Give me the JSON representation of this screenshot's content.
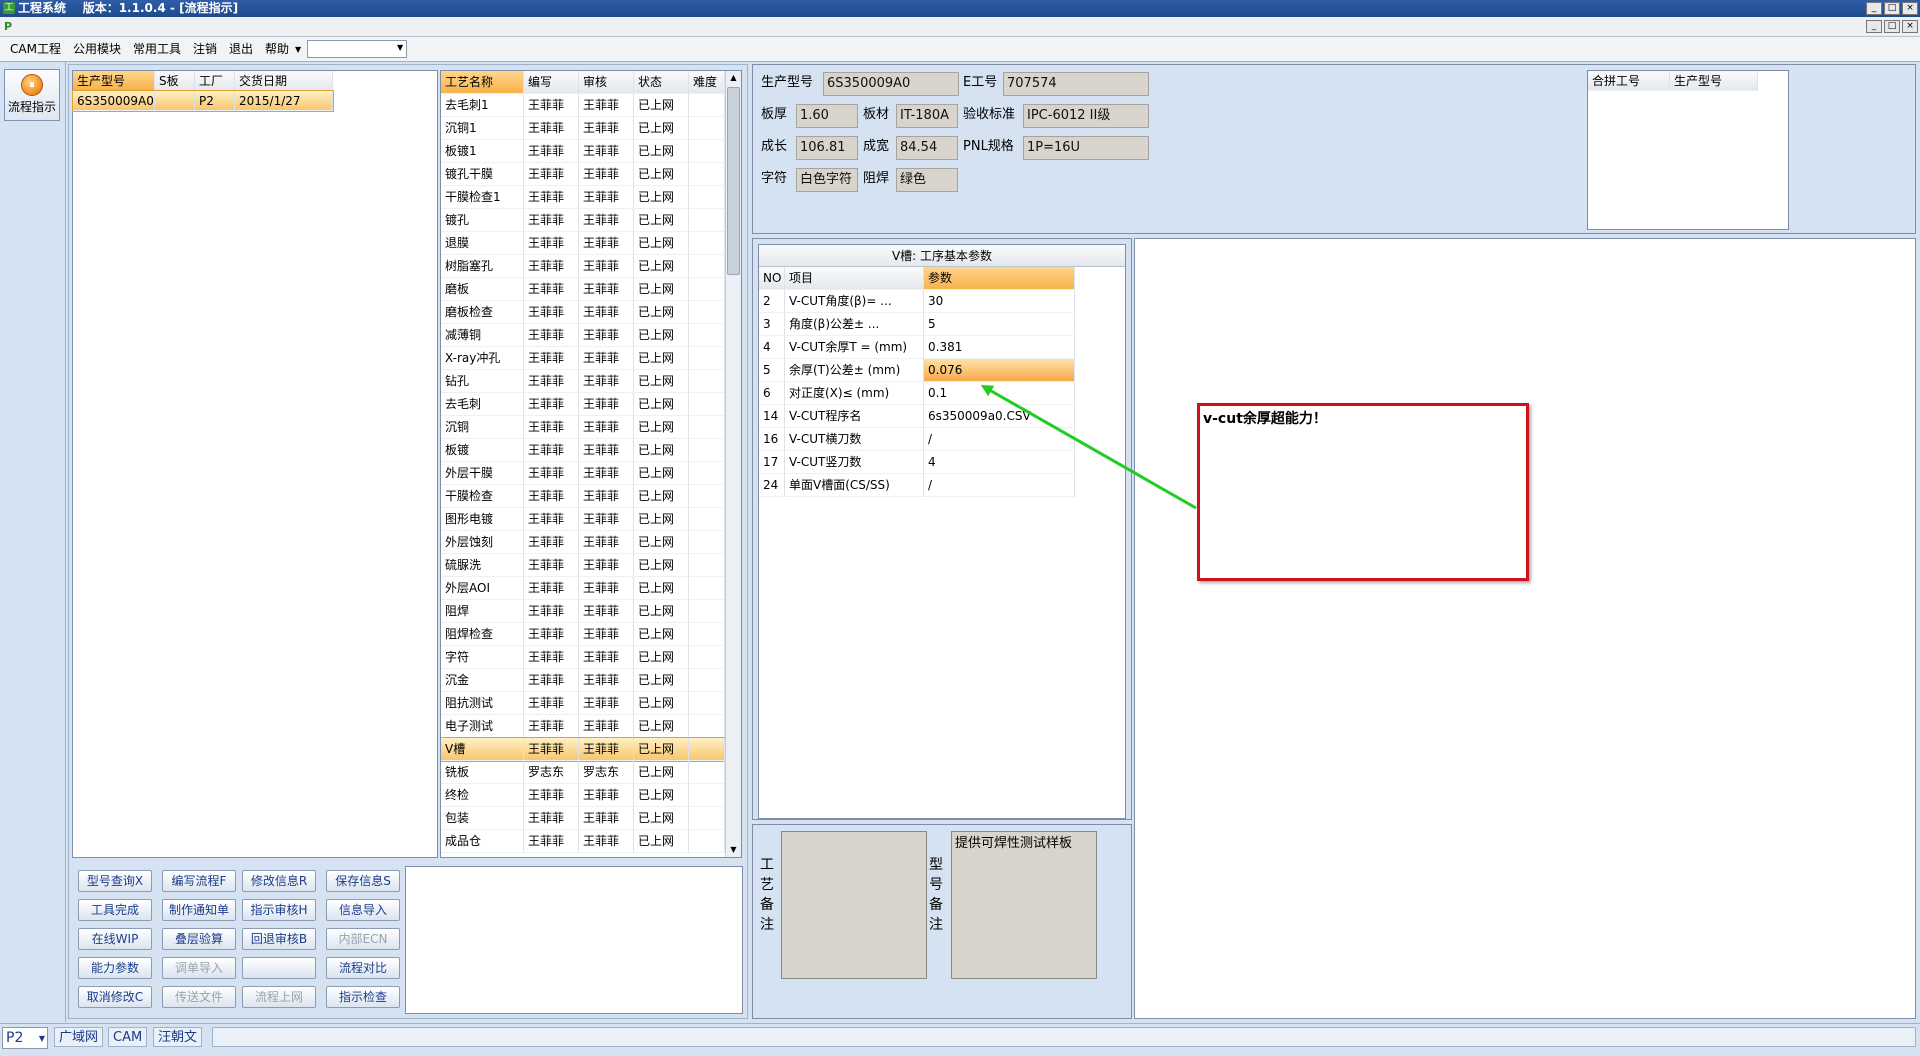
{
  "window": {
    "title": "工程系统    版本：1.1.0.4 - [流程指示]",
    "controls": [
      "_",
      "□",
      "×"
    ]
  },
  "mdi_controls": [
    "_",
    "□",
    "×"
  ],
  "menu": {
    "items": [
      "CAM工程",
      "公用模块",
      "常用工具",
      "注销",
      "退出",
      "帮助"
    ],
    "combo_value": ""
  },
  "left_rail": {
    "flow_button": "流程指示"
  },
  "orders": {
    "headers": [
      "生产型号",
      "S板",
      "工厂",
      "交货日期"
    ],
    "rows": [
      [
        "6S350009A0",
        "",
        "P2",
        "2015/1/27"
      ]
    ]
  },
  "process": {
    "headers": [
      "工艺名称",
      "编写",
      "审核",
      "状态",
      "难度"
    ],
    "rows": [
      [
        "去毛刺1",
        "王菲菲",
        "王菲菲",
        "已上网",
        ""
      ],
      [
        "沉铜1",
        "王菲菲",
        "王菲菲",
        "已上网",
        ""
      ],
      [
        "板镀1",
        "王菲菲",
        "王菲菲",
        "已上网",
        ""
      ],
      [
        "镀孔干膜",
        "王菲菲",
        "王菲菲",
        "已上网",
        ""
      ],
      [
        "干膜检查1",
        "王菲菲",
        "王菲菲",
        "已上网",
        ""
      ],
      [
        "镀孔",
        "王菲菲",
        "王菲菲",
        "已上网",
        ""
      ],
      [
        "退膜",
        "王菲菲",
        "王菲菲",
        "已上网",
        ""
      ],
      [
        "树脂塞孔",
        "王菲菲",
        "王菲菲",
        "已上网",
        ""
      ],
      [
        "磨板",
        "王菲菲",
        "王菲菲",
        "已上网",
        ""
      ],
      [
        "磨板检查",
        "王菲菲",
        "王菲菲",
        "已上网",
        ""
      ],
      [
        "减薄铜",
        "王菲菲",
        "王菲菲",
        "已上网",
        ""
      ],
      [
        "X-ray冲孔",
        "王菲菲",
        "王菲菲",
        "已上网",
        ""
      ],
      [
        "钻孔",
        "王菲菲",
        "王菲菲",
        "已上网",
        ""
      ],
      [
        "去毛刺",
        "王菲菲",
        "王菲菲",
        "已上网",
        ""
      ],
      [
        "沉铜",
        "王菲菲",
        "王菲菲",
        "已上网",
        ""
      ],
      [
        "板镀",
        "王菲菲",
        "王菲菲",
        "已上网",
        ""
      ],
      [
        "外层干膜",
        "王菲菲",
        "王菲菲",
        "已上网",
        ""
      ],
      [
        "干膜检查",
        "王菲菲",
        "王菲菲",
        "已上网",
        ""
      ],
      [
        "图形电镀",
        "王菲菲",
        "王菲菲",
        "已上网",
        ""
      ],
      [
        "外层蚀刻",
        "王菲菲",
        "王菲菲",
        "已上网",
        ""
      ],
      [
        "硫脲洗",
        "王菲菲",
        "王菲菲",
        "已上网",
        ""
      ],
      [
        "外层AOI",
        "王菲菲",
        "王菲菲",
        "已上网",
        ""
      ],
      [
        "阻焊",
        "王菲菲",
        "王菲菲",
        "已上网",
        ""
      ],
      [
        "阻焊检查",
        "王菲菲",
        "王菲菲",
        "已上网",
        ""
      ],
      [
        "字符",
        "王菲菲",
        "王菲菲",
        "已上网",
        ""
      ],
      [
        "沉金",
        "王菲菲",
        "王菲菲",
        "已上网",
        ""
      ],
      [
        "阻抗测试",
        "王菲菲",
        "王菲菲",
        "已上网",
        ""
      ],
      [
        "电子测试",
        "王菲菲",
        "王菲菲",
        "已上网",
        ""
      ],
      [
        "V槽",
        "王菲菲",
        "王菲菲",
        "已上网",
        ""
      ],
      [
        "铣板",
        "罗志东",
        "罗志东",
        "已上网",
        ""
      ],
      [
        "终检",
        "王菲菲",
        "王菲菲",
        "已上网",
        ""
      ],
      [
        "包装",
        "王菲菲",
        "王菲菲",
        "已上网",
        ""
      ],
      [
        "成品仓",
        "王菲菲",
        "王菲菲",
        "已上网",
        ""
      ]
    ],
    "selected_index": 28
  },
  "buttons": [
    [
      "型号查询X",
      "编写流程F",
      "修改信息R",
      "保存信息S"
    ],
    [
      "工具完成",
      "制作通知单",
      "指示审核H",
      "信息导入"
    ],
    [
      "在线WIP",
      "叠层验算",
      "回退审核B",
      "内部ECN"
    ],
    [
      "能力参数",
      "调单导入",
      "",
      "流程对比"
    ],
    [
      "取消修改C",
      "传送文件",
      "流程上网",
      "指示检查"
    ]
  ],
  "disabled_buttons": [
    "内部ECN",
    "调单导入",
    "",
    "传送文件",
    "流程上网"
  ],
  "info": {
    "labels": {
      "model": "生产型号",
      "e_no": "E工号",
      "thickness": "板厚",
      "material": "板材",
      "standard": "验收标准",
      "length": "成长",
      "width": "成宽",
      "pnl": "PNL规格",
      "legend": "字符",
      "mask": "阻焊"
    },
    "values": {
      "model": "6S350009A0",
      "e_no": "707574",
      "thickness": "1.60",
      "material": "IT-180A",
      "standard": "IPC-6012 II级",
      "length": "106.81",
      "width": "84.54",
      "pnl": "1P=16U",
      "legend": "白色字符",
      "mask": "绿色"
    }
  },
  "merge": {
    "headers": [
      "合拼工号",
      "生产型号"
    ]
  },
  "params": {
    "title": "V槽: 工序基本参数",
    "headers": [
      "NO",
      "项目",
      "参数"
    ],
    "rows": [
      [
        "2",
        "V-CUT角度(β)=  ...",
        "30"
      ],
      [
        "3",
        "角度(β)公差±  ...",
        "5"
      ],
      [
        "4",
        "V-CUT余厚T =  (mm)",
        "0.381"
      ],
      [
        "5",
        "余厚(T)公差±  (mm)",
        "0.076"
      ],
      [
        "6",
        "对正度(X)≤ (mm)",
        "0.1"
      ],
      [
        "14",
        "V-CUT程序名",
        "6s350009a0.CSV"
      ],
      [
        "16",
        "V-CUT横刀数",
        "/"
      ],
      [
        "17",
        "V-CUT竖刀数",
        "4"
      ],
      [
        "24",
        "单面V槽面(CS/SS)",
        "/"
      ]
    ],
    "highlight_index": 3
  },
  "remarks": {
    "process_label": "工艺备注",
    "model_label": "型号备注",
    "process_text": "",
    "model_text": "提供可焊性测试样板"
  },
  "annotation": {
    "text": "v-cut余厚超能力！",
    "border_color": "#d0101a",
    "arrow_color": "#22cc22"
  },
  "status": {
    "factory": "P2",
    "items": [
      "广域网",
      "CAM",
      "汪朝文"
    ]
  }
}
